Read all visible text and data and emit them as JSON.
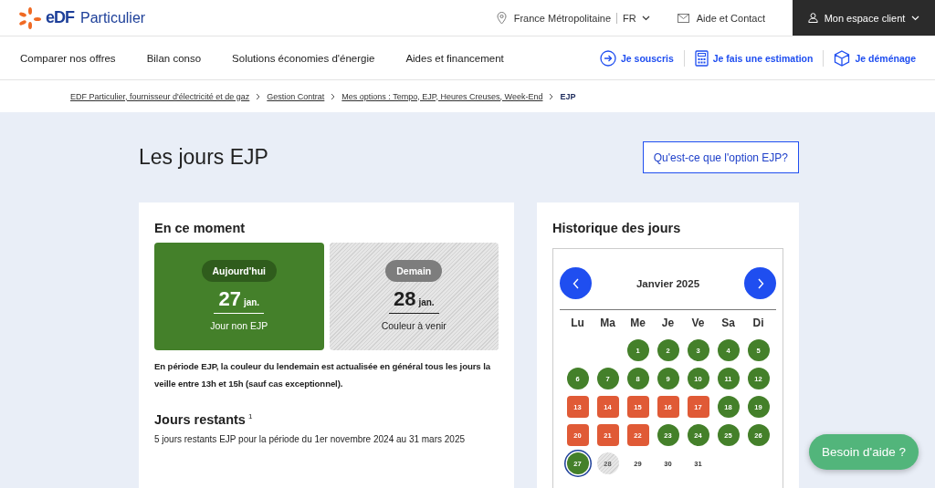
{
  "header": {
    "logo": "eDF",
    "brand": "Particulier",
    "region": "France Métropolitaine",
    "language": "FR",
    "contact": "Aide et Contact",
    "account": "Mon espace client"
  },
  "nav": {
    "items": [
      "Comparer nos offres",
      "Bilan conso",
      "Solutions économies d'énergie",
      "Aides et financement"
    ],
    "actions": [
      {
        "kind": "arrow",
        "label": "Je souscris"
      },
      {
        "kind": "calculator",
        "label": "Je fais une estimation"
      },
      {
        "kind": "box",
        "label": "Je déménage"
      }
    ]
  },
  "breadcrumb": [
    "EDF Particulier, fournisseur d'électricité et de gaz",
    "Gestion Contrat",
    "Mes options : Tempo, EJP, Heures Creuses, Week-End",
    "EJP"
  ],
  "page": {
    "title": "Les jours EJP",
    "info_button": "Qu'est-ce que l'option EJP?"
  },
  "current": {
    "heading": "En ce moment",
    "days": [
      {
        "badge": "Aujourd'hui",
        "day": "27",
        "month": "jan.",
        "status": "Jour non EJP",
        "kind": "non_ejp"
      },
      {
        "badge": "Demain",
        "day": "28",
        "month": "jan.",
        "status": "Couleur à venir",
        "kind": "pending"
      }
    ],
    "note": "En période EJP, la couleur du lendemain est actualisée en général tous les jours la veille entre 13h et 15h (sauf cas exceptionnel).",
    "remaining_heading": "Jours restants",
    "remaining_footnote": "1",
    "remaining_text": "5 jours restants EJP pour la période du 1er novembre 2024 au 31 mars 2025"
  },
  "history": {
    "heading": "Historique des jours",
    "month": "Janvier 2025",
    "weekdays": [
      "Lu",
      "Ma",
      "Me",
      "Je",
      "Ve",
      "Sa",
      "Di"
    ],
    "weeks": [
      [
        {
          "day": "1",
          "kind": "non_ejp",
          "selected": false
        },
        {
          "day": "2",
          "kind": "non_ejp",
          "selected": false
        },
        {
          "day": "3",
          "kind": "non_ejp",
          "selected": false
        },
        {
          "day": "4",
          "kind": "non_ejp",
          "selected": false
        },
        {
          "day": "5",
          "kind": "non_ejp",
          "selected": false
        }
      ],
      [
        {
          "day": "6",
          "kind": "non_ejp",
          "selected": false
        },
        {
          "day": "7",
          "kind": "non_ejp",
          "selected": false
        },
        {
          "day": "8",
          "kind": "non_ejp",
          "selected": false
        },
        {
          "day": "9",
          "kind": "non_ejp",
          "selected": false
        },
        {
          "day": "10",
          "kind": "non_ejp",
          "selected": false
        },
        {
          "day": "11",
          "kind": "non_ejp",
          "selected": false
        },
        {
          "day": "12",
          "kind": "non_ejp",
          "selected": false
        }
      ],
      [
        {
          "day": "13",
          "kind": "ejp",
          "selected": false
        },
        {
          "day": "14",
          "kind": "ejp",
          "selected": false
        },
        {
          "day": "15",
          "kind": "ejp",
          "selected": false
        },
        {
          "day": "16",
          "kind": "ejp",
          "selected": false
        },
        {
          "day": "17",
          "kind": "ejp",
          "selected": false
        },
        {
          "day": "18",
          "kind": "non_ejp",
          "selected": false
        },
        {
          "day": "19",
          "kind": "non_ejp",
          "selected": false
        }
      ],
      [
        {
          "day": "20",
          "kind": "ejp",
          "selected": false
        },
        {
          "day": "21",
          "kind": "ejp",
          "selected": false
        },
        {
          "day": "22",
          "kind": "ejp",
          "selected": false
        },
        {
          "day": "23",
          "kind": "non_ejp",
          "selected": false
        },
        {
          "day": "24",
          "kind": "non_ejp",
          "selected": false
        },
        {
          "day": "25",
          "kind": "non_ejp",
          "selected": false
        },
        {
          "day": "26",
          "kind": "non_ejp",
          "selected": false
        }
      ],
      [
        {
          "day": "27",
          "kind": "non_ejp",
          "selected": true
        },
        {
          "day": "28",
          "kind": "pending",
          "selected": false
        },
        {
          "day": "29",
          "kind": "future",
          "selected": false
        },
        {
          "day": "30",
          "kind": "future",
          "selected": false
        },
        {
          "day": "31",
          "kind": "future",
          "selected": false
        }
      ]
    ]
  },
  "help_button": "Besoin d'aide ?"
}
